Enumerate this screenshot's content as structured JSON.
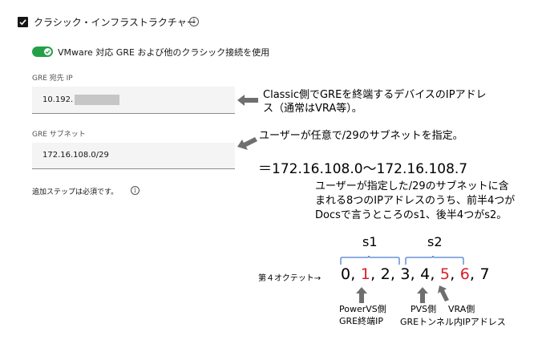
{
  "header": {
    "checkbox_checked": true,
    "title": "クラシック・インフラストラクチャー",
    "info_icon": "info-icon"
  },
  "toggle": {
    "on": true,
    "label": "VMware 対応 GRE および他のクラシック接続を使用"
  },
  "gre_ip": {
    "label": "GRE 宛先 IP",
    "value": "10.192."
  },
  "gre_subnet": {
    "label": "GRE サブネット",
    "value": "172.16.108.0/29"
  },
  "note": "追加ステップは必須です。",
  "annotations": {
    "ip_line1": "Classic側でGREを終端するデバイスのIPアドレ",
    "ip_line2": "ス（通常はVRA等）。",
    "subnet_line": "ユーザーが任意で/29のサブネットを指定。",
    "range": "＝172.16.108.0〜172.16.108.7",
    "explain_line1": "ユーザーが指定した/29のサブネットに含",
    "explain_line2": "まれる8つのIPアドレスのうち、前半4つが",
    "explain_line3": "Docsで言うところのs1、後半4つがs2。",
    "s1": "s1",
    "s2": "s2",
    "octet_label": "第４オクテット→",
    "octets": [
      {
        "v": "0",
        "sep": ", "
      },
      {
        "v": "1",
        "sep": ", "
      },
      {
        "v": "2",
        "sep": ", "
      },
      {
        "v": "3",
        "sep": ", "
      },
      {
        "v": "4",
        "sep": ", "
      },
      {
        "v": "5",
        "sep": ", "
      },
      {
        "v": "6",
        "sep": ", "
      },
      {
        "v": "7",
        "sep": ""
      }
    ],
    "powervs_line1": "PowerVS側",
    "powervs_line2": "GRE終端IP",
    "pvs": "PVS側",
    "vra": "VRA側",
    "tunnel": "GREトンネル内IPアドレス"
  },
  "colors": {
    "toggle_on": "#24a148",
    "highlight": "#da1e28",
    "arrow": "#6f6f6f",
    "bracket": "#4a7fd0"
  }
}
